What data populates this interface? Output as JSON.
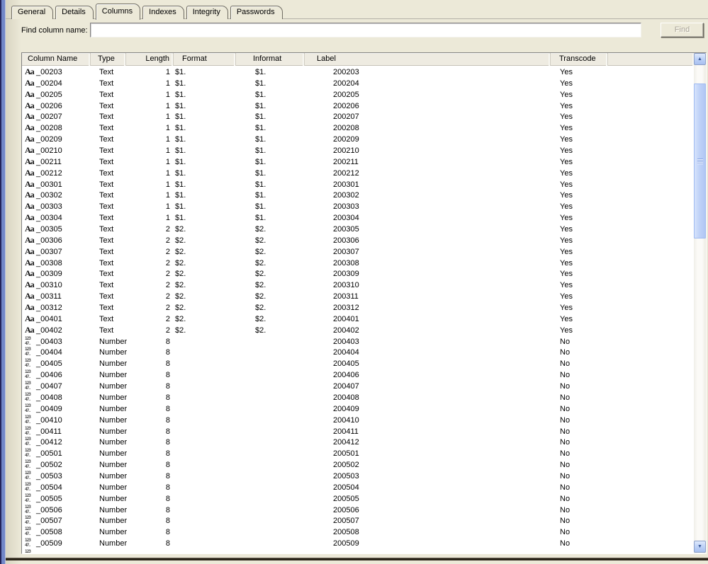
{
  "tabs": {
    "items": [
      {
        "label": "General",
        "active": false
      },
      {
        "label": "Details",
        "active": false
      },
      {
        "label": "Columns",
        "active": true
      },
      {
        "label": "Indexes",
        "active": false
      },
      {
        "label": "Integrity",
        "active": false
      },
      {
        "label": "Passwords",
        "active": false
      }
    ]
  },
  "find": {
    "label": "Find column name:",
    "value": "",
    "placeholder": "",
    "button_label": "Find",
    "button_enabled": false
  },
  "table": {
    "headers": [
      "Column Name",
      "Type",
      "Length",
      "Format",
      "Informat",
      "Label",
      "Transcode"
    ],
    "icons": {
      "text_icon": "Aa",
      "number_icon_line1": "123",
      "number_icon_line2": "47."
    },
    "rows": [
      {
        "icon": "text",
        "name": "_00203",
        "type": "Text",
        "length": "1",
        "format": "$1.",
        "informat": "$1.",
        "label": "200203",
        "transcode": "Yes"
      },
      {
        "icon": "text",
        "name": "_00204",
        "type": "Text",
        "length": "1",
        "format": "$1.",
        "informat": "$1.",
        "label": "200204",
        "transcode": "Yes"
      },
      {
        "icon": "text",
        "name": "_00205",
        "type": "Text",
        "length": "1",
        "format": "$1.",
        "informat": "$1.",
        "label": "200205",
        "transcode": "Yes"
      },
      {
        "icon": "text",
        "name": "_00206",
        "type": "Text",
        "length": "1",
        "format": "$1.",
        "informat": "$1.",
        "label": "200206",
        "transcode": "Yes"
      },
      {
        "icon": "text",
        "name": "_00207",
        "type": "Text",
        "length": "1",
        "format": "$1.",
        "informat": "$1.",
        "label": "200207",
        "transcode": "Yes"
      },
      {
        "icon": "text",
        "name": "_00208",
        "type": "Text",
        "length": "1",
        "format": "$1.",
        "informat": "$1.",
        "label": "200208",
        "transcode": "Yes"
      },
      {
        "icon": "text",
        "name": "_00209",
        "type": "Text",
        "length": "1",
        "format": "$1.",
        "informat": "$1.",
        "label": "200209",
        "transcode": "Yes"
      },
      {
        "icon": "text",
        "name": "_00210",
        "type": "Text",
        "length": "1",
        "format": "$1.",
        "informat": "$1.",
        "label": "200210",
        "transcode": "Yes"
      },
      {
        "icon": "text",
        "name": "_00211",
        "type": "Text",
        "length": "1",
        "format": "$1.",
        "informat": "$1.",
        "label": "200211",
        "transcode": "Yes"
      },
      {
        "icon": "text",
        "name": "_00212",
        "type": "Text",
        "length": "1",
        "format": "$1.",
        "informat": "$1.",
        "label": "200212",
        "transcode": "Yes"
      },
      {
        "icon": "text",
        "name": "_00301",
        "type": "Text",
        "length": "1",
        "format": "$1.",
        "informat": "$1.",
        "label": "200301",
        "transcode": "Yes"
      },
      {
        "icon": "text",
        "name": "_00302",
        "type": "Text",
        "length": "1",
        "format": "$1.",
        "informat": "$1.",
        "label": "200302",
        "transcode": "Yes"
      },
      {
        "icon": "text",
        "name": "_00303",
        "type": "Text",
        "length": "1",
        "format": "$1.",
        "informat": "$1.",
        "label": "200303",
        "transcode": "Yes"
      },
      {
        "icon": "text",
        "name": "_00304",
        "type": "Text",
        "length": "1",
        "format": "$1.",
        "informat": "$1.",
        "label": "200304",
        "transcode": "Yes"
      },
      {
        "icon": "text",
        "name": "_00305",
        "type": "Text",
        "length": "2",
        "format": "$2.",
        "informat": "$2.",
        "label": "200305",
        "transcode": "Yes"
      },
      {
        "icon": "text",
        "name": "_00306",
        "type": "Text",
        "length": "2",
        "format": "$2.",
        "informat": "$2.",
        "label": "200306",
        "transcode": "Yes"
      },
      {
        "icon": "text",
        "name": "_00307",
        "type": "Text",
        "length": "2",
        "format": "$2.",
        "informat": "$2.",
        "label": "200307",
        "transcode": "Yes"
      },
      {
        "icon": "text",
        "name": "_00308",
        "type": "Text",
        "length": "2",
        "format": "$2.",
        "informat": "$2.",
        "label": "200308",
        "transcode": "Yes"
      },
      {
        "icon": "text",
        "name": "_00309",
        "type": "Text",
        "length": "2",
        "format": "$2.",
        "informat": "$2.",
        "label": "200309",
        "transcode": "Yes"
      },
      {
        "icon": "text",
        "name": "_00310",
        "type": "Text",
        "length": "2",
        "format": "$2.",
        "informat": "$2.",
        "label": "200310",
        "transcode": "Yes"
      },
      {
        "icon": "text",
        "name": "_00311",
        "type": "Text",
        "length": "2",
        "format": "$2.",
        "informat": "$2.",
        "label": "200311",
        "transcode": "Yes"
      },
      {
        "icon": "text",
        "name": "_00312",
        "type": "Text",
        "length": "2",
        "format": "$2.",
        "informat": "$2.",
        "label": "200312",
        "transcode": "Yes"
      },
      {
        "icon": "text",
        "name": "_00401",
        "type": "Text",
        "length": "2",
        "format": "$2.",
        "informat": "$2.",
        "label": "200401",
        "transcode": "Yes"
      },
      {
        "icon": "text",
        "name": "_00402",
        "type": "Text",
        "length": "2",
        "format": "$2.",
        "informat": "$2.",
        "label": "200402",
        "transcode": "Yes"
      },
      {
        "icon": "number",
        "name": "_00403",
        "type": "Number",
        "length": "8",
        "format": "",
        "informat": "",
        "label": "200403",
        "transcode": "No"
      },
      {
        "icon": "number",
        "name": "_00404",
        "type": "Number",
        "length": "8",
        "format": "",
        "informat": "",
        "label": "200404",
        "transcode": "No"
      },
      {
        "icon": "number",
        "name": "_00405",
        "type": "Number",
        "length": "8",
        "format": "",
        "informat": "",
        "label": "200405",
        "transcode": "No"
      },
      {
        "icon": "number",
        "name": "_00406",
        "type": "Number",
        "length": "8",
        "format": "",
        "informat": "",
        "label": "200406",
        "transcode": "No"
      },
      {
        "icon": "number",
        "name": "_00407",
        "type": "Number",
        "length": "8",
        "format": "",
        "informat": "",
        "label": "200407",
        "transcode": "No"
      },
      {
        "icon": "number",
        "name": "_00408",
        "type": "Number",
        "length": "8",
        "format": "",
        "informat": "",
        "label": "200408",
        "transcode": "No"
      },
      {
        "icon": "number",
        "name": "_00409",
        "type": "Number",
        "length": "8",
        "format": "",
        "informat": "",
        "label": "200409",
        "transcode": "No"
      },
      {
        "icon": "number",
        "name": "_00410",
        "type": "Number",
        "length": "8",
        "format": "",
        "informat": "",
        "label": "200410",
        "transcode": "No"
      },
      {
        "icon": "number",
        "name": "_00411",
        "type": "Number",
        "length": "8",
        "format": "",
        "informat": "",
        "label": "200411",
        "transcode": "No"
      },
      {
        "icon": "number",
        "name": "_00412",
        "type": "Number",
        "length": "8",
        "format": "",
        "informat": "",
        "label": "200412",
        "transcode": "No"
      },
      {
        "icon": "number",
        "name": "_00501",
        "type": "Number",
        "length": "8",
        "format": "",
        "informat": "",
        "label": "200501",
        "transcode": "No"
      },
      {
        "icon": "number",
        "name": "_00502",
        "type": "Number",
        "length": "8",
        "format": "",
        "informat": "",
        "label": "200502",
        "transcode": "No"
      },
      {
        "icon": "number",
        "name": "_00503",
        "type": "Number",
        "length": "8",
        "format": "",
        "informat": "",
        "label": "200503",
        "transcode": "No"
      },
      {
        "icon": "number",
        "name": "_00504",
        "type": "Number",
        "length": "8",
        "format": "",
        "informat": "",
        "label": "200504",
        "transcode": "No"
      },
      {
        "icon": "number",
        "name": "_00505",
        "type": "Number",
        "length": "8",
        "format": "",
        "informat": "",
        "label": "200505",
        "transcode": "No"
      },
      {
        "icon": "number",
        "name": "_00506",
        "type": "Number",
        "length": "8",
        "format": "",
        "informat": "",
        "label": "200506",
        "transcode": "No"
      },
      {
        "icon": "number",
        "name": "_00507",
        "type": "Number",
        "length": "8",
        "format": "",
        "informat": "",
        "label": "200507",
        "transcode": "No"
      },
      {
        "icon": "number",
        "name": "_00508",
        "type": "Number",
        "length": "8",
        "format": "",
        "informat": "",
        "label": "200508",
        "transcode": "No"
      },
      {
        "icon": "number",
        "name": "_00509",
        "type": "Number",
        "length": "8",
        "format": "",
        "informat": "",
        "label": "200509",
        "transcode": "No"
      },
      {
        "icon": "number",
        "name": "",
        "type": "",
        "length": "",
        "format": "",
        "informat": "",
        "label": "",
        "transcode": "",
        "partial": true
      }
    ]
  },
  "colors": {
    "dialog_bg": "#ece9d8",
    "header_bg": "#eeebe1",
    "window_edge_blue": "#7287c8",
    "scroll_thumb": "#c2d4f8",
    "scroll_arrow": "#3c5b9a",
    "disabled_text": "#a8a397",
    "bottom_rule": "#2a2418"
  }
}
